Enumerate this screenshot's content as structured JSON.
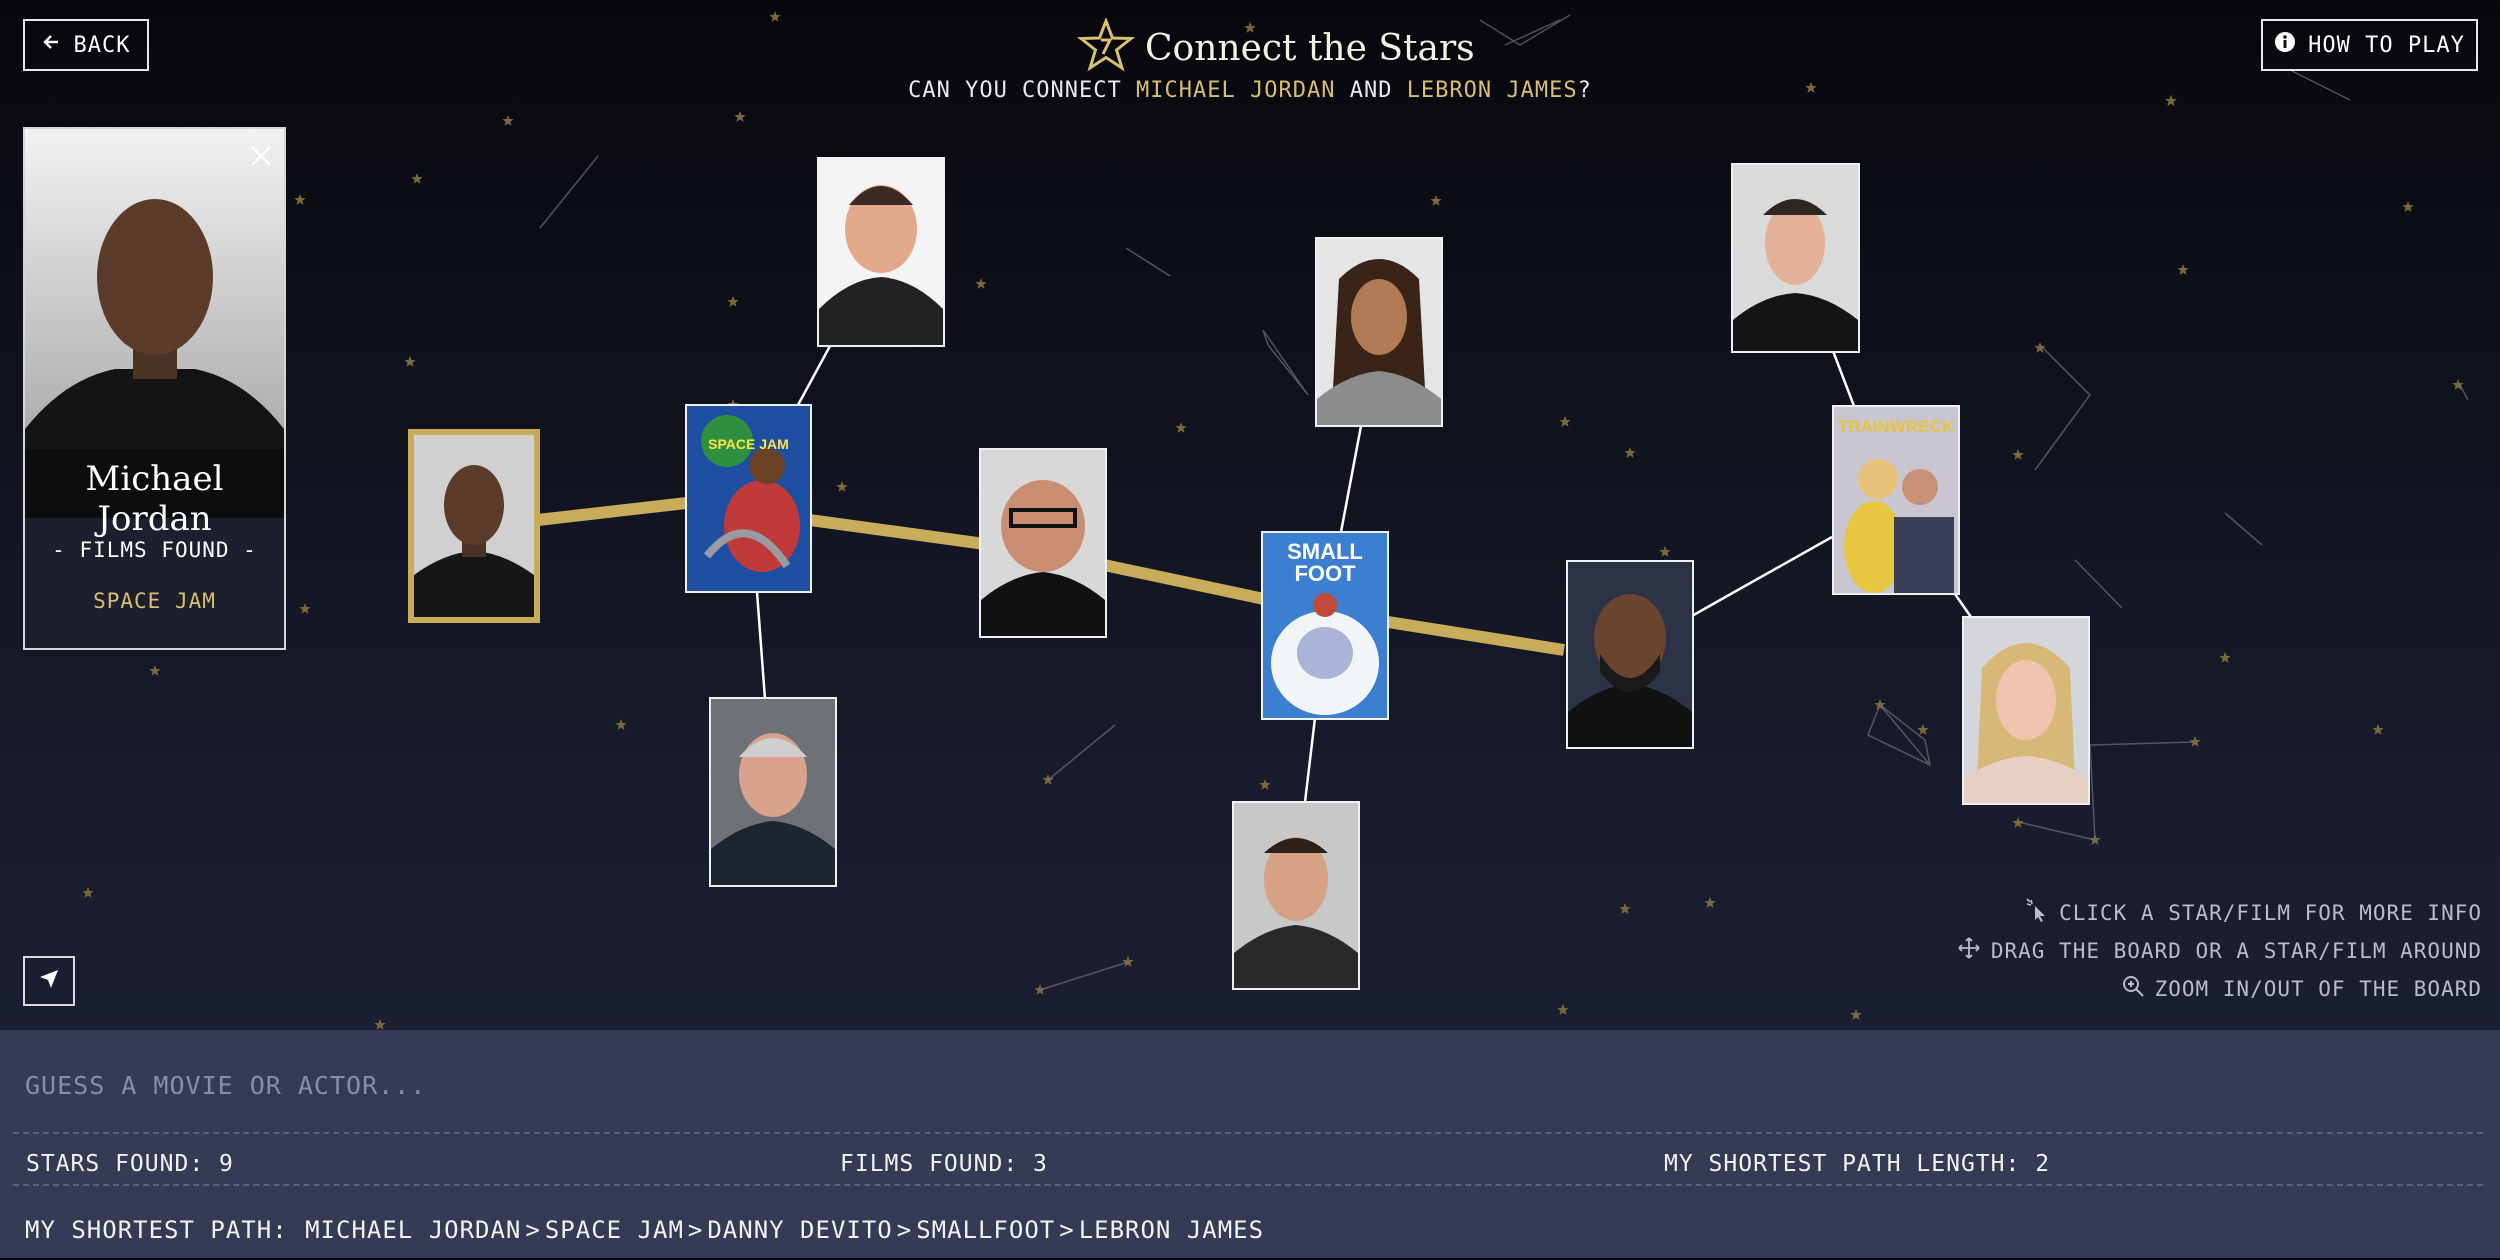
{
  "header": {
    "back_label": "BACK",
    "title": "Connect the Stars",
    "subtitle_prefix": "CAN YOU CONNECT ",
    "start_star": "MICHAEL JORDAN",
    "subtitle_and": " AND ",
    "end_star": "LEBRON JAMES",
    "subtitle_suffix": "?",
    "how_to_play_label": "HOW TO PLAY"
  },
  "info_card": {
    "name": "Michael Jordan",
    "films_found_label": "- FILMS FOUND -",
    "films": [
      "SPACE JAM"
    ]
  },
  "board": {
    "film_posters": {
      "space_jam": "SPACE JAM",
      "smallfoot_line1": "SMALL",
      "smallfoot_line2": "FOOT",
      "trainwreck": "TRAINWRECK"
    }
  },
  "hints": {
    "click": "CLICK A STAR/FILM FOR MORE INFO",
    "drag": "DRAG THE BOARD OR A STAR/FILM AROUND",
    "zoom": "ZOOM IN/OUT OF THE BOARD"
  },
  "panel": {
    "guess_placeholder": "GUESS A MOVIE OR ACTOR...",
    "stars_found_label": "STARS FOUND:",
    "stars_found": "9",
    "films_found_label": "FILMS FOUND:",
    "films_found": "3",
    "shortest_len_label": "MY SHORTEST PATH LENGTH:",
    "shortest_len": "2",
    "path_label": "MY SHORTEST PATH:",
    "path": [
      "MICHAEL JORDAN",
      "SPACE JAM",
      "DANNY DEVITO",
      "SMALLFOOT",
      "LEBRON JAMES"
    ],
    "path_sep": ">"
  },
  "colors": {
    "accent_gold": "#d9bf72",
    "path_gold": "#c8ac5a",
    "panel_bg": "#353a55"
  }
}
